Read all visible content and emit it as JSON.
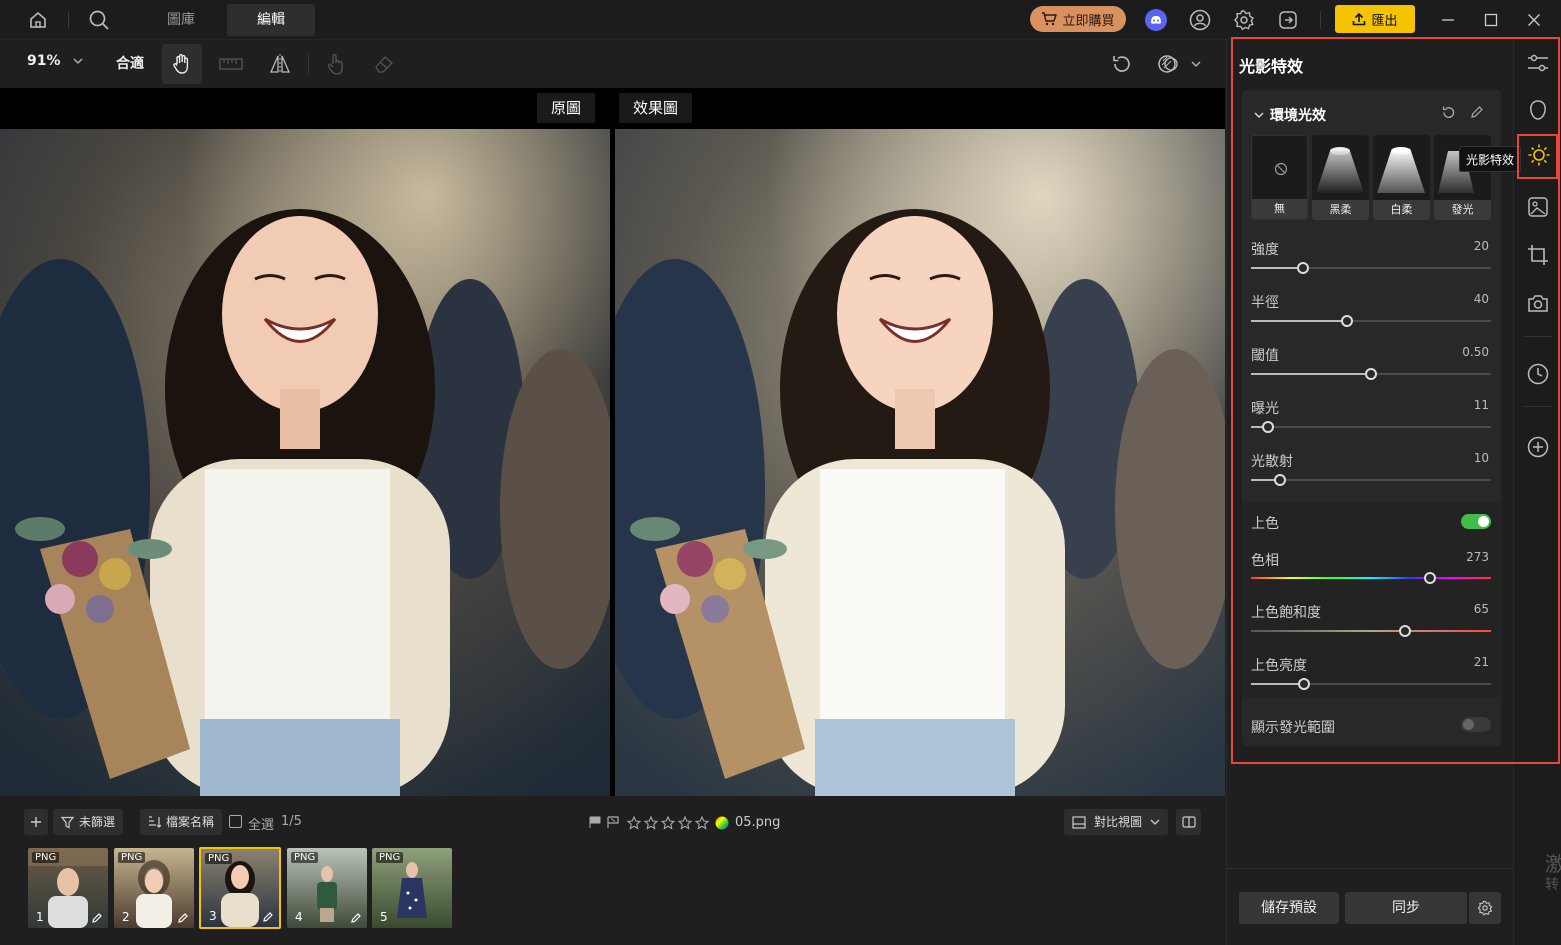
{
  "topbar": {
    "tabs": [
      {
        "label": "圖庫"
      },
      {
        "label": "編輯"
      }
    ],
    "buy_label": "立即購買",
    "export_label": "匯出",
    "colors": {
      "buy_bg": "#d8915f",
      "export_bg": "#f5c400"
    }
  },
  "toolbar": {
    "zoom": "91%",
    "fit_label": "合適"
  },
  "viewer": {
    "original_label": "原圖",
    "effect_label": "效果圖"
  },
  "bottombar": {
    "filter_label": "未篩選",
    "sort_label": "檔案名稱",
    "select_all_label": "全選",
    "count": "1/5",
    "filename": "05.png",
    "compare_view_label": "對比視圖",
    "thumbnails": [
      {
        "format": "PNG",
        "number": "1"
      },
      {
        "format": "PNG",
        "number": "2"
      },
      {
        "format": "PNG",
        "number": "3"
      },
      {
        "format": "PNG",
        "number": "4"
      },
      {
        "format": "PNG",
        "number": "5"
      }
    ]
  },
  "panel": {
    "title": "光影特效",
    "section_title": "環境光效",
    "presets": [
      {
        "label": "無"
      },
      {
        "label": "黑柔"
      },
      {
        "label": "白柔"
      },
      {
        "label": "發光"
      }
    ],
    "sliders": [
      {
        "label": "強度",
        "value": "20",
        "fraction": 0.215
      },
      {
        "label": "半徑",
        "value": "40",
        "fraction": 0.4
      },
      {
        "label": "閾值",
        "value": "0.50",
        "fraction": 0.5
      },
      {
        "label": "曝光",
        "value": "11",
        "fraction": 0.07
      },
      {
        "label": "光散射",
        "value": "10",
        "fraction": 0.12
      }
    ],
    "tint": {
      "label": "上色",
      "enabled": true,
      "hue": {
        "label": "色相",
        "value": "273",
        "fraction": 0.745
      },
      "saturation": {
        "label": "上色飽和度",
        "value": "65",
        "fraction": 0.64
      },
      "brightness": {
        "label": "上色亮度",
        "value": "21",
        "fraction": 0.22
      }
    },
    "show_glow_label": "顯示發光範圍",
    "save_preset_label": "儲存預設",
    "sync_label": "同步",
    "toggle_color": "#3fbf4a"
  },
  "rail": {
    "tooltip": "光影特效",
    "active_color": "#f5c400"
  },
  "watermark": {
    "line1": "激",
    "line2": "转"
  }
}
